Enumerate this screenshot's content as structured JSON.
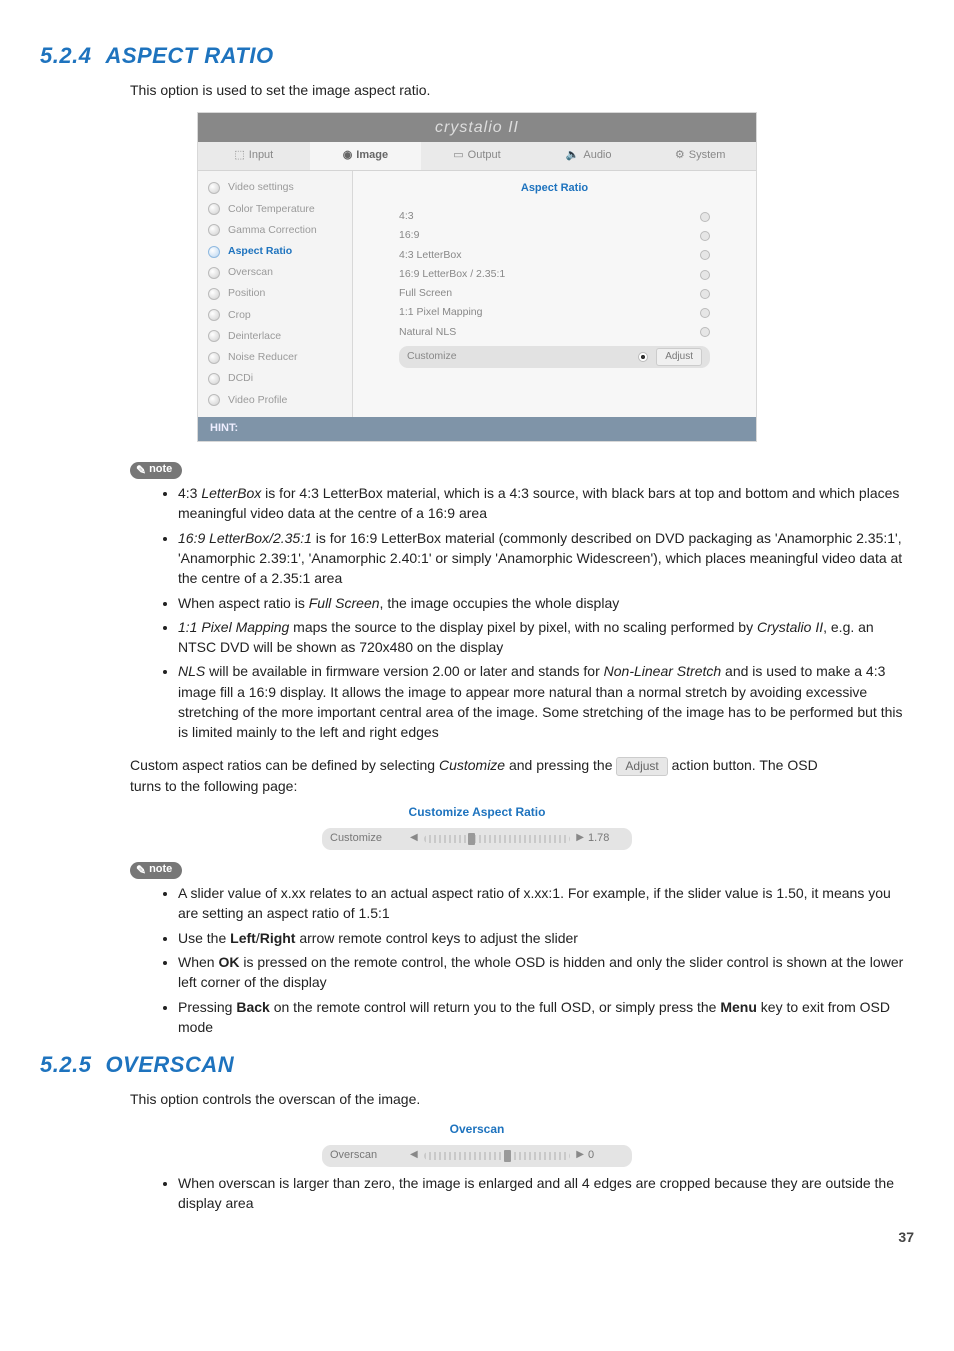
{
  "sections": {
    "aspect": {
      "num": "5.2.4",
      "title": "ASPECT RATIO",
      "intro": "This option is used to set the image aspect ratio."
    },
    "overscan": {
      "num": "5.2.5",
      "title": "OVERSCAN",
      "intro": "This option controls the overscan of the image."
    }
  },
  "screenshot": {
    "logo": "crystalio II",
    "tabs": {
      "input": "Input",
      "image": "Image",
      "output": "Output",
      "audio": "Audio",
      "system": "System"
    },
    "sidebar": [
      "Video settings",
      "Color Temperature",
      "Gamma Correction",
      "Aspect Ratio",
      "Overscan",
      "Position",
      "Crop",
      "Deinterlace",
      "Noise Reducer",
      "DCDi",
      "Video Profile"
    ],
    "panel_title": "Aspect Ratio",
    "options": [
      "4:3",
      "16:9",
      "4:3 LetterBox",
      "16:9 LetterBox / 2.35:1",
      "Full Screen",
      "1:1 Pixel Mapping",
      "Natural NLS"
    ],
    "customize": "Customize",
    "adjust_label": "Adjust",
    "hint": "HINT:"
  },
  "note_label": "note",
  "notes1": {
    "a_pre": "4:3 ",
    "a_em": "LetterBox",
    "a_post": " is for 4:3 LetterBox material, which is a 4:3 source, with black bars at top and bottom and which places meaningful video data at the centre of a 16:9 area",
    "b_em": "16:9 LetterBox/2.35:1",
    "b_post": " is for 16:9 LetterBox material (commonly described on DVD packaging as 'Anamorphic 2.35:1', 'Anamorphic 2.39:1', 'Anamorphic 2.40:1' or simply 'Anamorphic Widescreen'), which places meaningful video data at the centre of a 2.35:1 area",
    "c_pre": "When aspect ratio is ",
    "c_em": "Full Screen",
    "c_post": ", the image occupies the whole display",
    "d_em": "1:1 Pixel Mapping",
    "d_mid": " maps the source to the display pixel by pixel, with no scaling performed by ",
    "d_em2": "Crystalio II",
    "d_post": ", e.g. an NTSC DVD will be shown as 720x480 on the display",
    "e_em": "NLS",
    "e_mid": " will be available in firmware version 2.00 or later and stands for ",
    "e_em2": "Non-Linear Stretch",
    "e_post": " and is used to make a 4:3 image fill a 16:9 display. It allows the image to appear more natural than a normal stretch by avoiding excessive stretching of the more important central area of the image. Some stretching of the image has to be performed but this is limited mainly to the left and right edges"
  },
  "custom_para": {
    "pre": "Custom aspect ratios can be defined by selecting ",
    "em": "Customize",
    "mid": " and pressing the ",
    "btn": "Adjust",
    "post": " action button. The OSD turns to the following page:"
  },
  "mini_custom": {
    "title": "Customize Aspect Ratio",
    "label": "Customize",
    "value": "1.78"
  },
  "notes2": {
    "a": "A slider value of x.xx relates to an actual aspect ratio of x.xx:1. For example, if the slider value is 1.50, it means you are setting an aspect ratio of 1.5:1",
    "b_pre": "Use the ",
    "b_b1": "Left",
    "b_slash": "/",
    "b_b2": "Right",
    "b_post": " arrow remote control keys to adjust the slider",
    "c_pre": "When ",
    "c_b": "OK",
    "c_post": " is pressed on the remote control, the whole OSD is hidden and only the slider control is shown at the lower left corner of the display",
    "d_pre": "Pressing ",
    "d_b1": "Back",
    "d_mid": " on the remote control will return you to the full OSD, or simply press the ",
    "d_b2": "Menu",
    "d_post": " key to exit from OSD mode"
  },
  "mini_overscan": {
    "title": "Overscan",
    "label": "Overscan",
    "value": "0"
  },
  "notes3": {
    "a": "When overscan is larger than zero, the image is enlarged and all 4 edges are cropped because they are outside the display area"
  },
  "page_number": "37"
}
